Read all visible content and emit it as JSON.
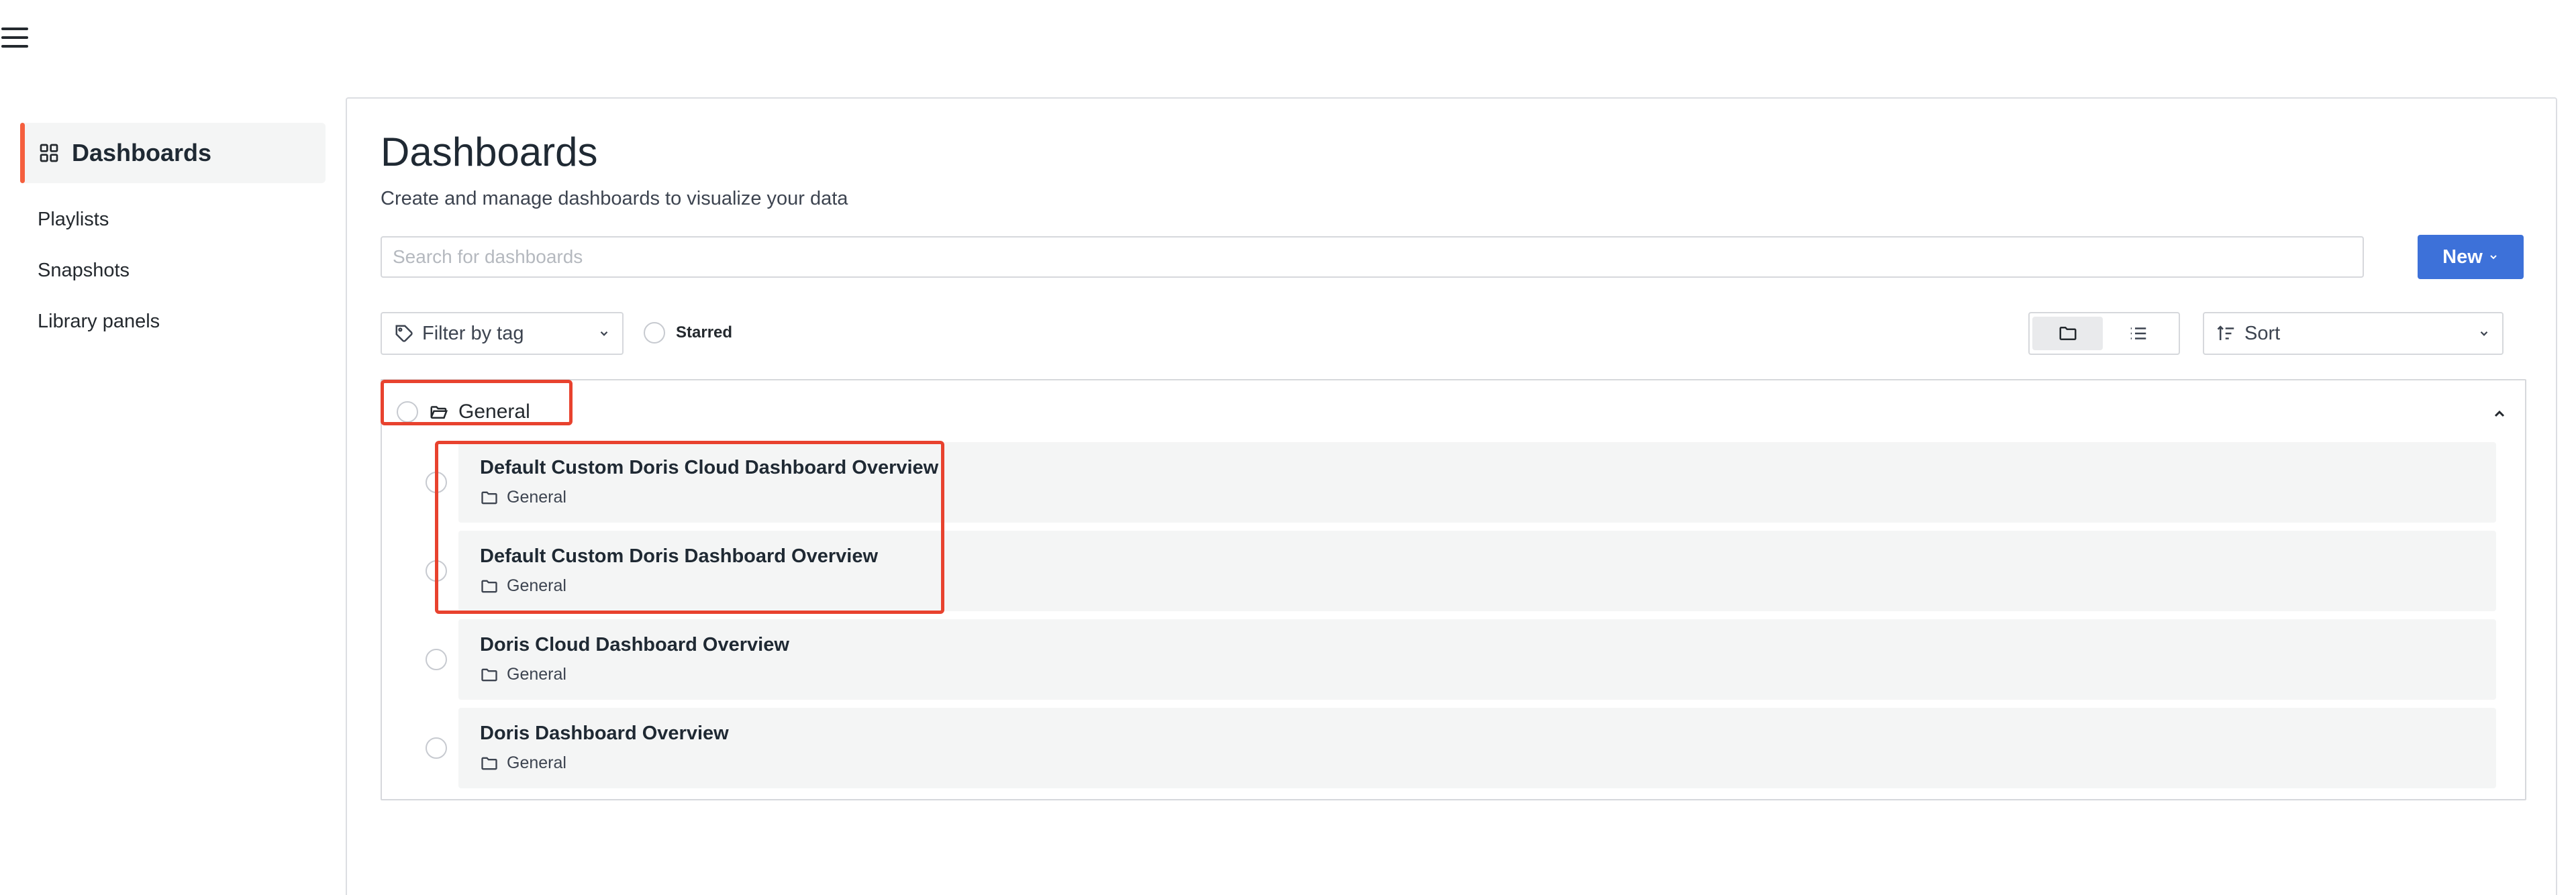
{
  "sidebar": {
    "active_label": "Dashboards",
    "items": [
      {
        "label": "Playlists"
      },
      {
        "label": "Snapshots"
      },
      {
        "label": "Library panels"
      }
    ]
  },
  "page": {
    "title": "Dashboards",
    "subtitle": "Create and manage dashboards to visualize your data"
  },
  "search": {
    "placeholder": "Search for dashboards",
    "value": ""
  },
  "toolbar": {
    "new_label": "New",
    "filter_label": "Filter by tag",
    "starred_label": "Starred",
    "sort_label": "Sort"
  },
  "folder": {
    "name": "General",
    "dashboards": [
      {
        "title": "Default Custom Doris Cloud Dashboard Overview",
        "location": "General"
      },
      {
        "title": "Default Custom Doris Dashboard Overview",
        "location": "General"
      },
      {
        "title": "Doris Cloud Dashboard Overview",
        "location": "General"
      },
      {
        "title": "Doris Dashboard Overview",
        "location": "General"
      }
    ]
  },
  "colors": {
    "accent": "#f55f3e",
    "primary_button": "#3d71d9",
    "annotation": "#e8422e"
  }
}
